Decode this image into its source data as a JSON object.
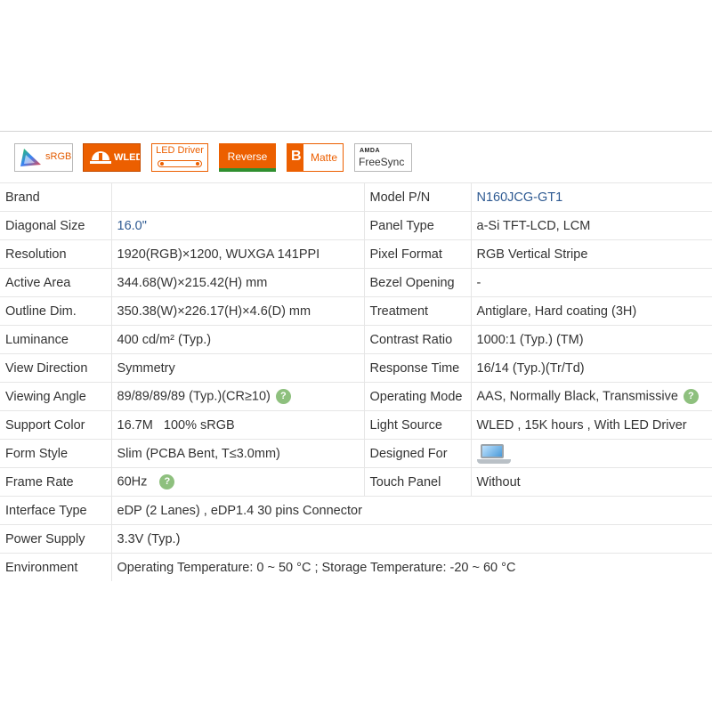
{
  "badges": {
    "srgb": "sRGB",
    "wled": "WLED",
    "led_driver": "LED Driver",
    "reverse": "Reverse",
    "matte_letter": "B",
    "matte": "Matte",
    "amd": "AMDA",
    "freesync": "FreeSync"
  },
  "colors": {
    "accent": "#ec5f00",
    "link": "#2e5a92",
    "help": "#8ec07e"
  },
  "help_glyph": "?",
  "specs": {
    "brand": {
      "label": "Brand",
      "value": ""
    },
    "model": {
      "label": "Model P/N",
      "value": "N160JCG-GT1"
    },
    "diagonal": {
      "label": "Diagonal Size",
      "value": "16.0\""
    },
    "panel_type": {
      "label": "Panel Type",
      "value": "a-Si TFT-LCD, LCM"
    },
    "resolution": {
      "label": "Resolution",
      "value": "1920(RGB)×1200, WUXGA  141PPI"
    },
    "pixel_format": {
      "label": "Pixel Format",
      "value": "RGB Vertical Stripe"
    },
    "active_area": {
      "label": "Active Area",
      "value": "344.68(W)×215.42(H) mm"
    },
    "bezel": {
      "label": "Bezel Opening",
      "value": "-"
    },
    "outline": {
      "label": "Outline Dim.",
      "value": "350.38(W)×226.17(H)×4.6(D) mm"
    },
    "treatment": {
      "label": "Treatment",
      "value": "Antiglare, Hard coating (3H)"
    },
    "luminance": {
      "label": "Luminance",
      "value": "400 cd/m² (Typ.)"
    },
    "contrast": {
      "label": "Contrast Ratio",
      "value": "1000:1 (Typ.) (TM)"
    },
    "view_direction": {
      "label": "View Direction",
      "value": "Symmetry"
    },
    "response": {
      "label": "Response Time",
      "value": "16/14 (Typ.)(Tr/Td)"
    },
    "viewing_angle": {
      "label": "Viewing Angle",
      "value": "89/89/89/89 (Typ.)(CR≥10)"
    },
    "operating_mode": {
      "label": "Operating Mode",
      "value": "AAS, Normally Black, Transmissive"
    },
    "support_color": {
      "label": "Support Color",
      "value": "16.7M   100% sRGB"
    },
    "light_source": {
      "label": "Light Source",
      "value": "WLED , 15K hours , With LED Driver"
    },
    "form_style": {
      "label": "Form Style",
      "value": "Slim (PCBA Bent, T≤3.0mm)"
    },
    "designed_for": {
      "label": "Designed For",
      "icon": "laptop-icon"
    },
    "frame_rate": {
      "label": "Frame Rate",
      "value": "60Hz"
    },
    "touch_panel": {
      "label": "Touch Panel",
      "value": "Without"
    },
    "interface": {
      "label": "Interface Type",
      "value": "eDP (2 Lanes) , eDP1.4 30 pins Connector"
    },
    "power": {
      "label": "Power Supply",
      "value": "3.3V (Typ.)"
    },
    "environment": {
      "label": "Environment",
      "value": "Operating Temperature: 0 ~ 50 °C ; Storage Temperature: -20 ~ 60 °C"
    }
  }
}
